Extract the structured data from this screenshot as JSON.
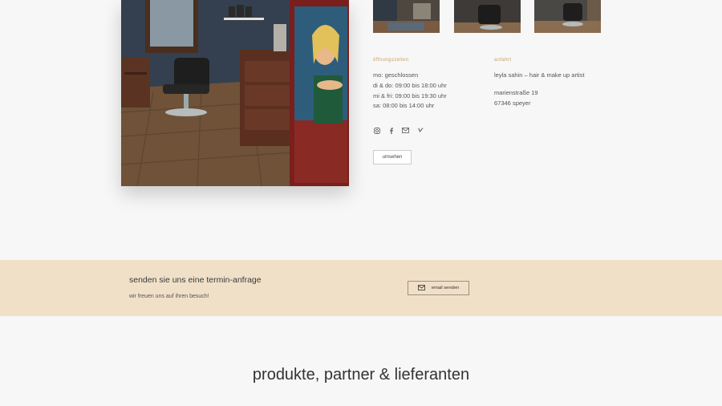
{
  "hours": {
    "heading": "öffnungszeiten",
    "lines": [
      "mo: geschlossen",
      "di & do: 09:00 bis 18:00 uhr",
      "mi & fri: 09:00 bis 19:30 uhr",
      "sa: 08:00 bis 14:00 uhr"
    ]
  },
  "directions": {
    "heading": "anfahrt",
    "name": "leyla sahin – hair & make up artist",
    "street": "marienstraße 19",
    "city": "67346 speyer"
  },
  "social_icons": [
    "instagram-icon",
    "facebook-icon",
    "email-icon",
    "vimeo-icon"
  ],
  "buttons": {
    "umsehen": "umsehen",
    "email": "email senden"
  },
  "cta": {
    "title": "senden sie uns eine termin-anfrage",
    "subtitle": "wir freuen uns auf ihren besuch!",
    "background": "#f1e0c8"
  },
  "section": {
    "title": "produkte, partner & lieferanten"
  },
  "colors": {
    "accent": "#c9a063",
    "background": "#f7f7f7"
  }
}
